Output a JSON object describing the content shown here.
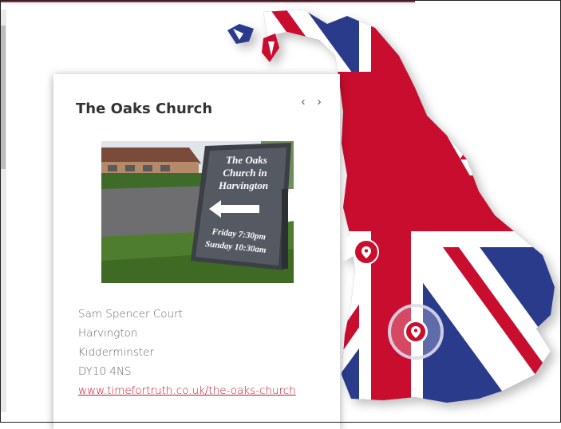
{
  "card": {
    "title": "The Oaks Church",
    "nav_prev": "‹",
    "nav_next": "›",
    "sign_text": [
      "The Oaks",
      "Church in",
      "Harvington"
    ],
    "sign_times": [
      "Friday 7:30pm",
      "Sunday 10:30am"
    ],
    "address": {
      "line1": "Sam Spencer Court",
      "line2": "Harvington",
      "line3": "Kidderminster",
      "postcode": "DY10 4NS",
      "link": "www.timefortruth.co.uk/the-oaks-church"
    }
  },
  "colors": {
    "union_red": "#c8102e",
    "union_blue": "#2b3a8c",
    "marker_red": "#c8102e"
  },
  "icons": [
    "map-pin-icon",
    "chevron-left-icon",
    "chevron-right-icon"
  ]
}
